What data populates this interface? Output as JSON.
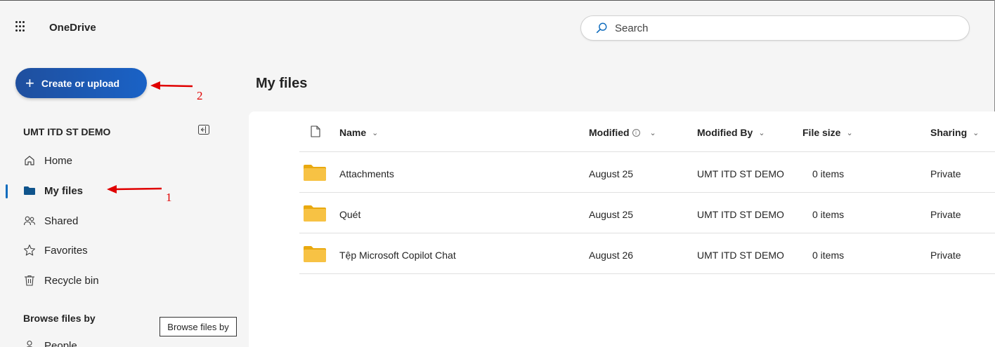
{
  "header": {
    "app_title": "OneDrive",
    "search_placeholder": "Search"
  },
  "create_button": {
    "label": "Create or upload"
  },
  "annotations": {
    "label_1": "1",
    "label_2": "2",
    "arrow_color": "#e00000"
  },
  "sidebar": {
    "org_name": "UMT ITD ST DEMO",
    "items": [
      {
        "label": "Home",
        "icon": "home-icon"
      },
      {
        "label": "My files",
        "icon": "folder-icon",
        "active": true
      },
      {
        "label": "Shared",
        "icon": "people-icon"
      },
      {
        "label": "Favorites",
        "icon": "star-icon"
      },
      {
        "label": "Recycle bin",
        "icon": "trash-icon"
      }
    ],
    "browse_title": "Browse files by",
    "browse_tooltip": "Browse files by",
    "browse_items": [
      {
        "label": "People",
        "icon": "person-icon"
      }
    ]
  },
  "main": {
    "title": "My files",
    "columns": {
      "name": "Name",
      "modified": "Modified",
      "modified_by": "Modified By",
      "file_size": "File size",
      "sharing": "Sharing"
    },
    "files": [
      {
        "name": "Attachments",
        "modified": "August 25",
        "modified_by": "UMT ITD ST DEMO",
        "size": "0 items",
        "sharing": "Private"
      },
      {
        "name": "Quét",
        "modified": "August 25",
        "modified_by": "UMT ITD ST DEMO",
        "size": "0 items",
        "sharing": "Private"
      },
      {
        "name": "Tệp Microsoft Copilot Chat",
        "modified": "August 26",
        "modified_by": "UMT ITD ST DEMO",
        "size": "0 items",
        "sharing": "Private"
      }
    ]
  },
  "colors": {
    "accent": "#0f6cbd",
    "button_start": "#1f4f9e",
    "button_end": "#1a62c6",
    "folder": "#f7c244"
  }
}
